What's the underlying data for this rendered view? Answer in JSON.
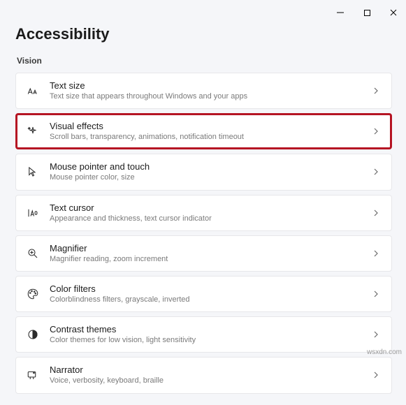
{
  "header": {
    "title": "Accessibility"
  },
  "section": {
    "label": "Vision"
  },
  "items": [
    {
      "title": "Text size",
      "sub": "Text size that appears throughout Windows and your apps"
    },
    {
      "title": "Visual effects",
      "sub": "Scroll bars, transparency, animations, notification timeout"
    },
    {
      "title": "Mouse pointer and touch",
      "sub": "Mouse pointer color, size"
    },
    {
      "title": "Text cursor",
      "sub": "Appearance and thickness, text cursor indicator"
    },
    {
      "title": "Magnifier",
      "sub": "Magnifier reading, zoom increment"
    },
    {
      "title": "Color filters",
      "sub": "Colorblindness filters, grayscale, inverted"
    },
    {
      "title": "Contrast themes",
      "sub": "Color themes for low vision, light sensitivity"
    },
    {
      "title": "Narrator",
      "sub": "Voice, verbosity, keyboard, braille"
    }
  ],
  "watermark": "wsxdn.com"
}
